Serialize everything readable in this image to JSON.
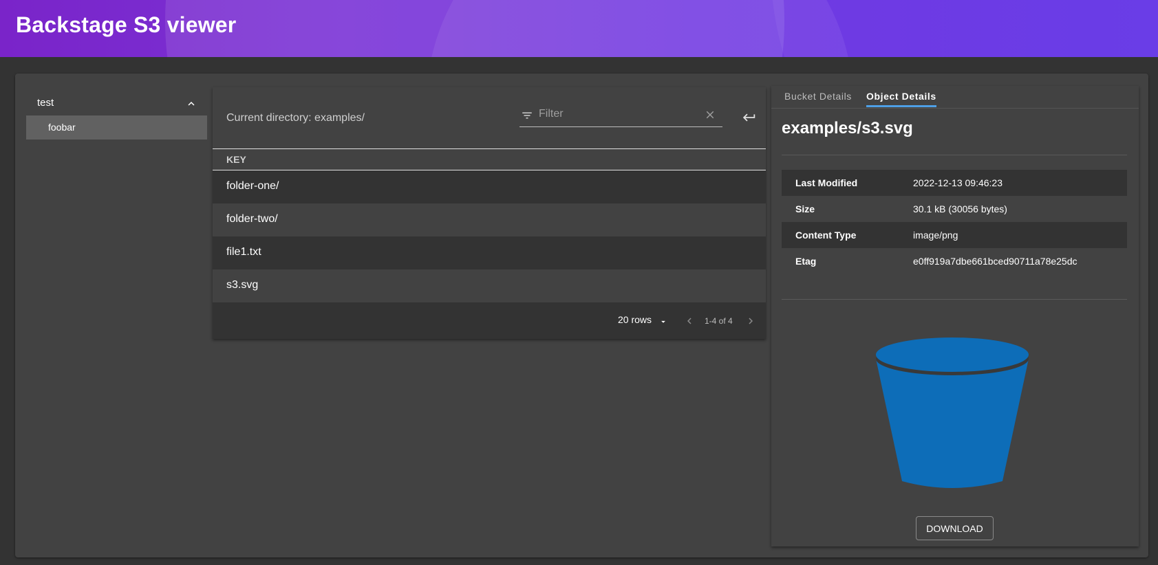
{
  "app": {
    "title": "Backstage S3 viewer"
  },
  "tree": {
    "root_label": "test",
    "child_label": "foobar"
  },
  "browser": {
    "current_directory": "Current directory: examples/",
    "filter_placeholder": "Filter",
    "column_header": "KEY",
    "rows": [
      "folder-one/",
      "folder-two/",
      "file1.txt",
      "s3.svg"
    ],
    "rows_per_page": "20 rows",
    "range": "1-4 of 4"
  },
  "details": {
    "tabs": [
      "Bucket Details",
      "Object Details"
    ],
    "active_tab": "Object Details",
    "title": "examples/s3.svg",
    "properties": [
      {
        "key": "Last Modified",
        "value": "2022-12-13 09:46:23"
      },
      {
        "key": "Size",
        "value": "30.1 kB (30056 bytes)"
      },
      {
        "key": "Content Type",
        "value": "image/png"
      },
      {
        "key": "Etag",
        "value": "e0ff919a7dbe661bced90711a78e25dc"
      }
    ],
    "download_label": "DOWNLOAD"
  },
  "icons": [
    "chevron-up-icon",
    "filter-icon",
    "clear-icon",
    "enter-icon",
    "dropdown-caret-icon",
    "chevron-left-icon",
    "chevron-right-icon",
    "s3-bucket-icon"
  ],
  "colors": {
    "header_start": "#7a24c9",
    "header_end": "#6233e6",
    "accent": "#4ea0e6",
    "bucket": "#0d6db8"
  }
}
